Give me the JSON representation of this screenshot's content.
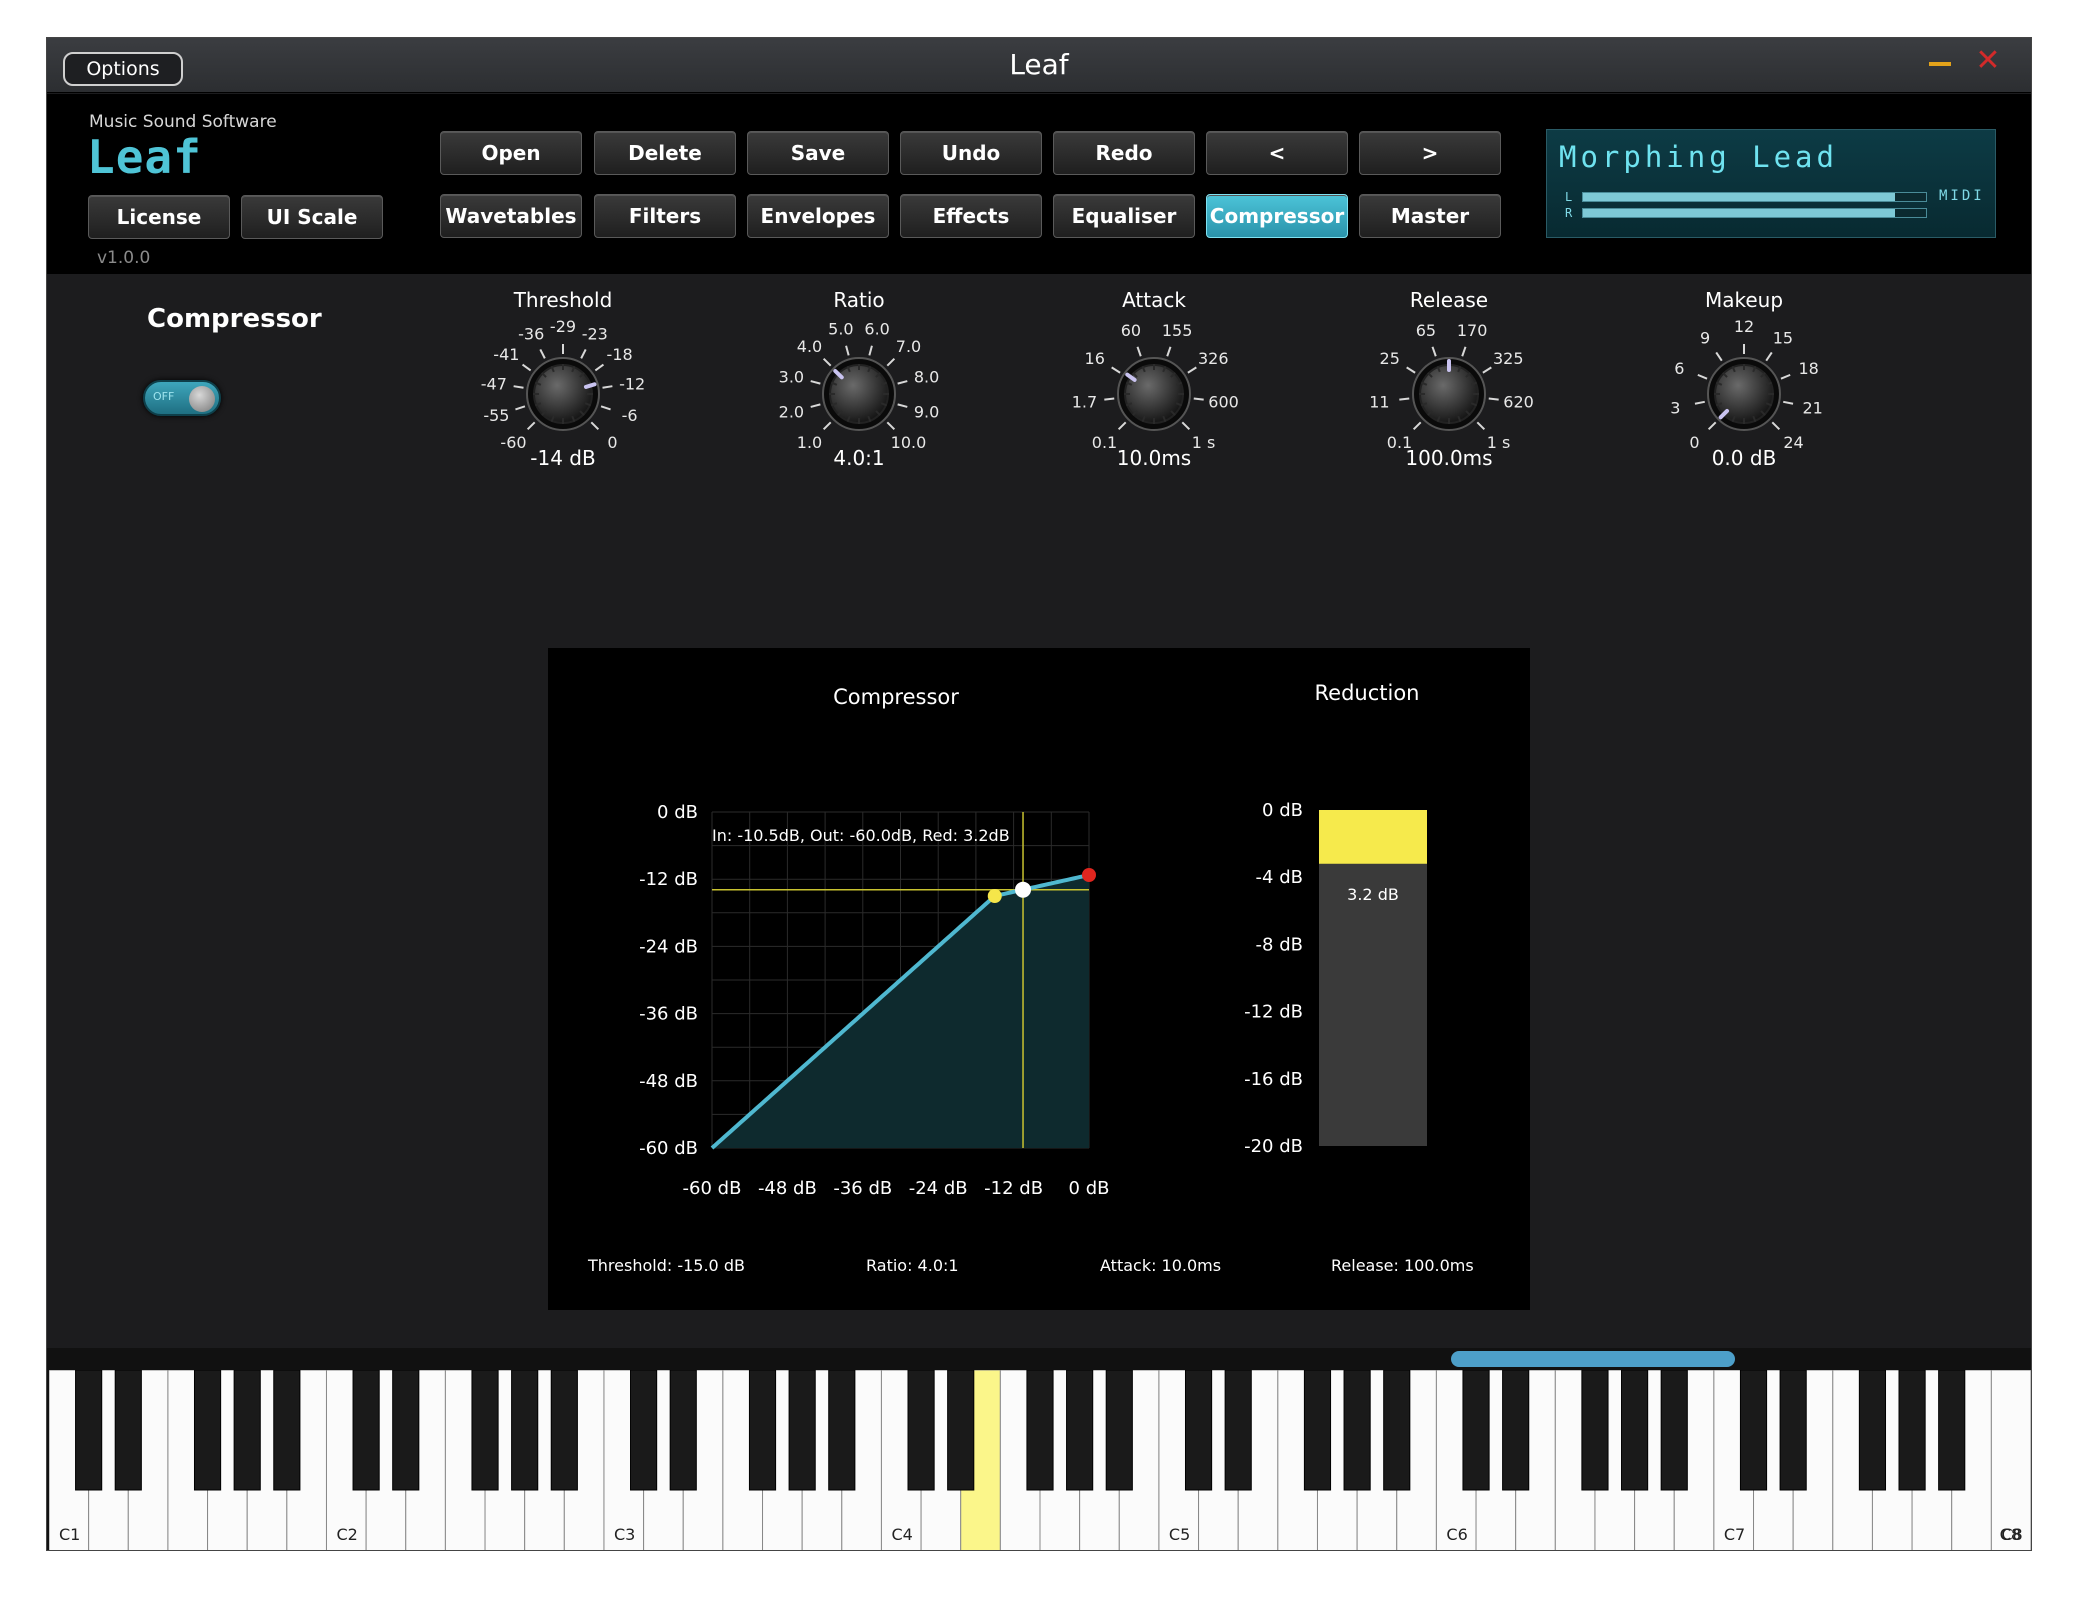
{
  "window": {
    "title": "Leaf",
    "options_label": "Options"
  },
  "header": {
    "brand": "Music Sound Software",
    "logo": "Leaf",
    "version": "v1.0.0",
    "license_label": "License",
    "ui_scale_label": "UI Scale",
    "top_buttons": [
      "Open",
      "Delete",
      "Save",
      "Undo",
      "Redo",
      "<",
      ">"
    ],
    "tabs": [
      "Wavetables",
      "Filters",
      "Envelopes",
      "Effects",
      "Equaliser",
      "Compressor",
      "Master"
    ],
    "active_tab": "Compressor"
  },
  "lcd": {
    "preset_name": "Morphing Lead",
    "left_label": "L",
    "right_label": "R",
    "left_level": 0.91,
    "right_level": 0.91,
    "midi_label": "MIDI"
  },
  "compressor": {
    "title": "Compressor",
    "toggle_label": "OFF",
    "knobs": [
      {
        "name": "Threshold",
        "value": "-14 dB",
        "position": 0.77,
        "ticks": [
          "-60",
          "-55",
          "-47",
          "-41",
          "-36",
          "-29",
          "-23",
          "-18",
          "-12",
          "-6",
          "0"
        ]
      },
      {
        "name": "Ratio",
        "value": "4.0:1",
        "position": 0.33,
        "ticks": [
          "1.0",
          "2.0",
          "3.0",
          "4.0",
          "5.0",
          "6.0",
          "7.0",
          "8.0",
          "9.0",
          "10.0"
        ]
      },
      {
        "name": "Attack",
        "value": "10.0ms",
        "position": 0.3,
        "ticks": [
          "0.1",
          "1.7",
          "16",
          "60",
          "155",
          "326",
          "600",
          "1 s"
        ]
      },
      {
        "name": "Release",
        "value": "100.0ms",
        "position": 0.5,
        "ticks": [
          "0.1",
          "11",
          "25",
          "65",
          "170",
          "325",
          "620",
          "1 s"
        ]
      },
      {
        "name": "Makeup",
        "value": "0.0 dB",
        "position": 0.0,
        "ticks": [
          "0",
          "3",
          "6",
          "9",
          "12",
          "15",
          "18",
          "21",
          "24"
        ]
      }
    ]
  },
  "graph": {
    "title": "Compressor",
    "reduction_title": "Reduction",
    "readout": "In: -10.5dB, Out: -60.0dB, Red: 3.2dB",
    "y_ticks": [
      "0 dB",
      "-12 dB",
      "-24 dB",
      "-36 dB",
      "-48 dB",
      "-60 dB"
    ],
    "x_ticks": [
      "-60 dB",
      "-48 dB",
      "-36 dB",
      "-24 dB",
      "-12 dB",
      "0 dB"
    ],
    "reduction_ticks": [
      "0 dB",
      "-4 dB",
      "-8 dB",
      "-12 dB",
      "-16 dB",
      "-20 dB"
    ],
    "reduction_value": "3.2 dB",
    "reduction_db": 3.2,
    "footer": {
      "threshold": "Threshold: -15.0 dB",
      "ratio": "Ratio: 4.0:1",
      "attack": "Attack: 10.0ms",
      "release": "Release: 100.0ms"
    },
    "curve": {
      "threshold_db": -15.0,
      "ratio": 4.0,
      "input_marker_db": -10.5
    },
    "colors": {
      "curve": "#4fb8d0",
      "fill": "#0e2a2e",
      "threshold_point": "#f5e64a",
      "input_point": "#ffffff",
      "end_point": "#e0261f",
      "crosshair": "#c8c230",
      "reduction_bar": "#f6ea4c"
    }
  },
  "keyboard": {
    "octave_labels": [
      "C1",
      "C2",
      "C3",
      "C4",
      "C5",
      "C6",
      "C7",
      "C8"
    ],
    "highlight_color": "#fbf68a"
  }
}
